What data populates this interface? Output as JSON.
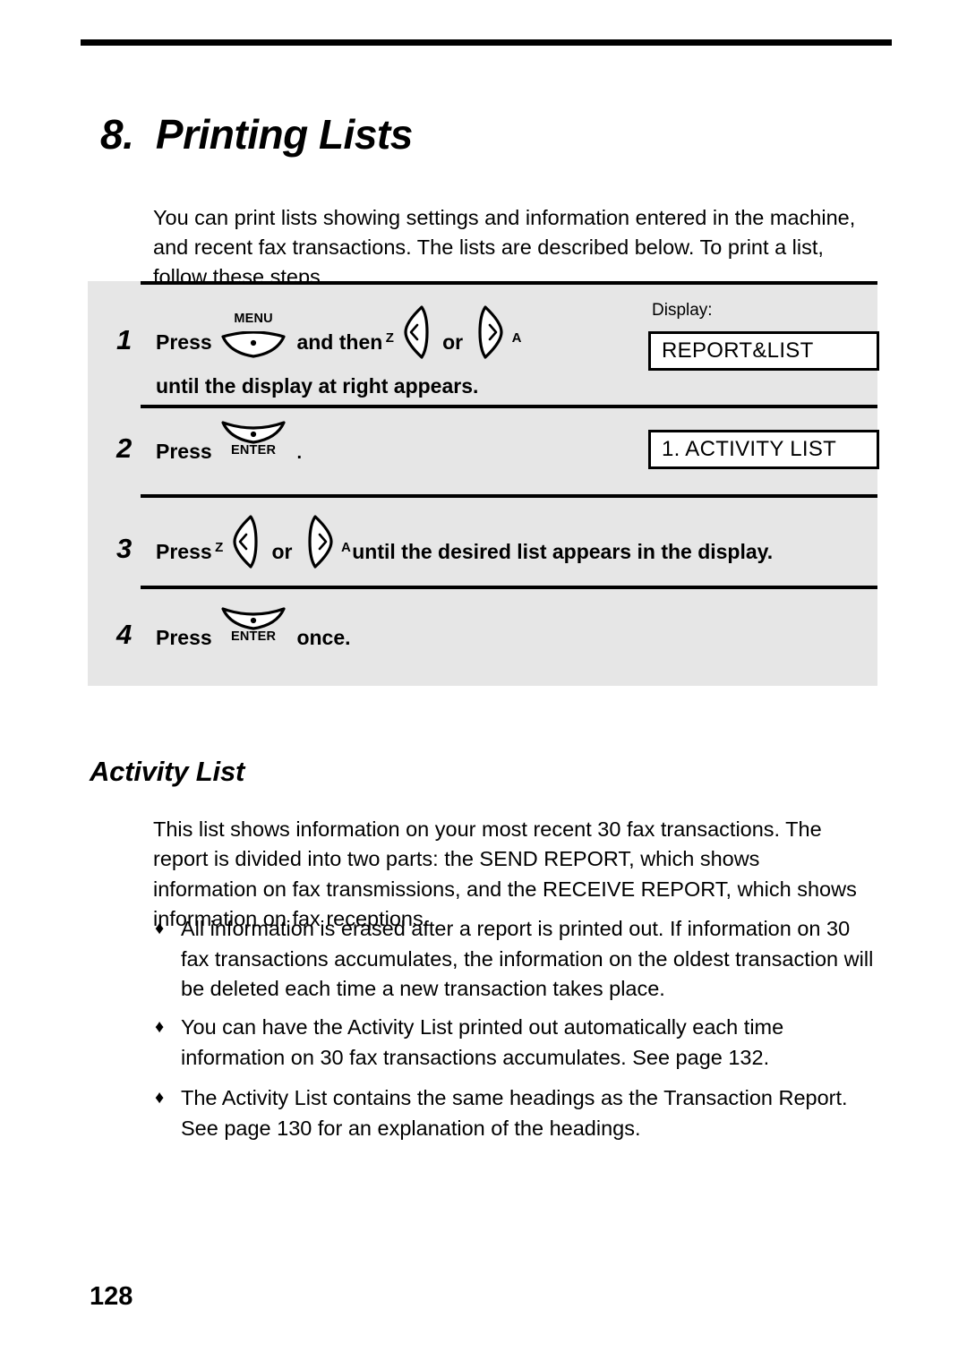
{
  "document": {
    "chapter_title": "8.  Printing Lists",
    "intro": "You can print lists showing settings and information entered in the machine, and recent fax transactions. The lists are described below. To print a list, follow these steps.",
    "page_number": "128"
  },
  "procedure": {
    "display_label": "Display:",
    "steps": [
      {
        "number": "1",
        "press_label": "Press",
        "key1_caption": "MENU",
        "middle_text": "and then",
        "key_left_letter": "Z",
        "or_text": "or",
        "key_right_letter": "A",
        "line2": "until the display at right appears.",
        "display_value": "REPORT&LIST"
      },
      {
        "number": "2",
        "press_label": "Press",
        "key1_caption": "ENTER",
        "trailing_text": ".",
        "display_value": "1. ACTIVITY LIST"
      },
      {
        "number": "3",
        "press_label": "Press",
        "key_left_letter": "Z",
        "or_text": "or",
        "key_right_letter": "A",
        "tail_text": "until the desired list appears in the display."
      },
      {
        "number": "4",
        "press_label": "Press",
        "key1_caption": "ENTER",
        "tail_text": "once."
      }
    ]
  },
  "section": {
    "heading": "Activity List",
    "paragraph": "This list shows information on your most recent 30 fax transactions. The report is divided into two parts: the SEND REPORT, which shows information on fax transmissions, and the RECEIVE REPORT, which shows information on fax receptions.",
    "bullet_mark": "♦",
    "bullets": [
      "All information is erased after a report is printed out. If information on 30 fax transactions accumulates, the information on the oldest transaction will be deleted each time a new transaction takes place.",
      "You can have the Activity List printed out automatically each time information on 30 fax transactions accumulates. See page 132.",
      "The Activity List contains the same headings as the Transaction Report. See page 130 for an explanation of the headings."
    ]
  },
  "colors": {
    "panel_background": "#e6e6e6",
    "ink": "#000000",
    "page_background": "#ffffff"
  }
}
